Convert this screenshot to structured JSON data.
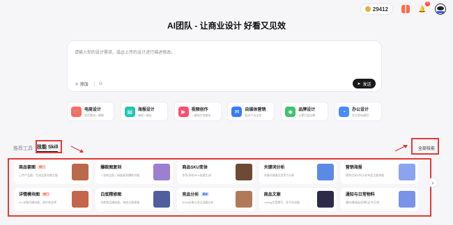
{
  "topbar": {
    "credits": "29412",
    "notif_count": "6"
  },
  "title": "AI团队 - 让商业设计 好看又见效",
  "input": {
    "placeholder": "请输入你的设计需求，或@上传的设计进行描述修改。",
    "add_label": "添加",
    "send_label": "发送"
  },
  "categories": [
    {
      "title": "电商设计",
      "desc": "卖货素材一键做",
      "color": "#ff6b5b",
      "icon": "cart-icon"
    },
    {
      "title": "海报设计",
      "desc": "海报一键出",
      "color": "#1fc6b3",
      "icon": "poster-icon"
    },
    {
      "title": "视频创作",
      "desc": "一键成片免脚本",
      "color": "#ff4d6d",
      "icon": "video-icon"
    },
    {
      "title": "自媒体营销",
      "desc": "图文产出全包",
      "color": "#3a7bff",
      "icon": "megaphone-icon"
    },
    {
      "title": "品牌设计",
      "desc": "从零打造品牌",
      "color": "#3ec46d",
      "icon": "brand-icon"
    },
    {
      "title": "办公设计",
      "desc": "学生职场通用",
      "color": "#4a8bff",
      "icon": "office-icon"
    }
  ],
  "tabs": {
    "recommend": "推荐工具",
    "skill": "技能 Skill"
  },
  "all_skills": "全部技能",
  "skills": [
    {
      "name": "商品套图",
      "tag": "热门",
      "tag_type": "hot",
      "desc": "上传产品图，生成全套电商主图",
      "thumb": "#b86a4a"
    },
    {
      "name": "爆款图复刻",
      "tag": "",
      "tag_type": "",
      "desc": "一张商品图，搞复复刻爆款风格",
      "thumb": "#9c7fd0"
    },
    {
      "name": "商品SKU变体",
      "tag": "",
      "tag_type": "",
      "desc": "多色/多款SKU批量生成",
      "thumb": "#6c4a34"
    },
    {
      "name": "关键词分析",
      "tag": "",
      "tag_type": "",
      "desc": "关键词流量及竞争力分析",
      "thumb": "#5a8ae6"
    },
    {
      "name": "营销海报",
      "tag": "",
      "tag_type": "",
      "desc": "营销/活动/节日/发布会主图海报",
      "thumb": "#8aa4f0"
    },
    {
      "name": "详情模块图",
      "tag": "热门",
      "tag_type": "hot",
      "desc": "A+/详情页模块图，提升转化率",
      "thumb": "#c4664a"
    },
    {
      "name": "白底精修图",
      "tag": "",
      "tag_type": "",
      "desc": "白底商品精修图，电商主图规格",
      "thumb": "#4f5f9e"
    },
    {
      "name": "竞品分析",
      "tag": "最新",
      "tag_type": "new",
      "desc": "ASIN诊断与竞品洞察分析",
      "thumb": "#b07a5a"
    },
    {
      "name": "商品文案",
      "tag": "",
      "tag_type": "",
      "desc": "Listing文案撰写，多平台适配",
      "thumb": "#2c2c4a"
    },
    {
      "name": "通知与日常物料",
      "tag": "",
      "tag_type": "",
      "desc": "通知/邀请函/招聘/证书/日常",
      "thumb": "#7a92e8"
    }
  ]
}
